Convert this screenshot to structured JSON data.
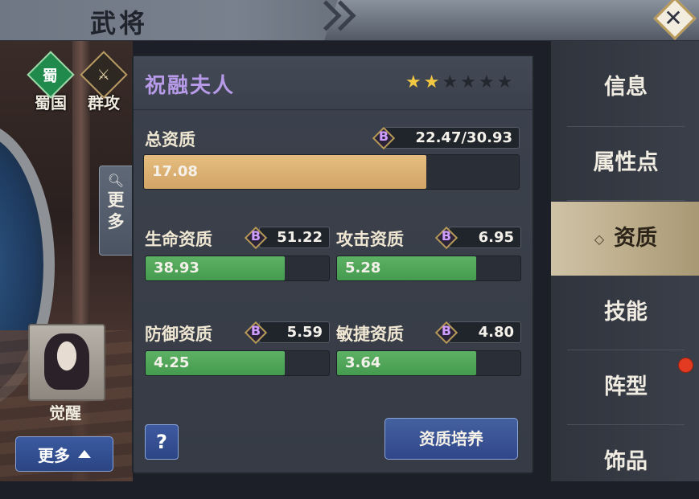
{
  "title": "武将",
  "factions": [
    {
      "emblem": "蜀",
      "label": "蜀国",
      "color": "#1f8a4c"
    },
    {
      "emblem": "⚔",
      "label": "群攻",
      "color": "#b89a62"
    }
  ],
  "side_more_tab": "更多",
  "awaken_label": "觉醒",
  "more_button": "更多",
  "hero": {
    "name": "祝融夫人",
    "stars_filled": 2,
    "stars_total": 6
  },
  "total": {
    "label": "总资质",
    "grade": "B",
    "range": "22.47/30.93",
    "current": "17.08",
    "fill_fraction": 0.754
  },
  "stats": [
    {
      "label": "生命资质",
      "grade": "B",
      "cap": "51.22",
      "current": "38.93",
      "fill_fraction": 0.76
    },
    {
      "label": "攻击资质",
      "grade": "B",
      "cap": "6.95",
      "current": "5.28",
      "fill_fraction": 0.76
    },
    {
      "label": "防御资质",
      "grade": "B",
      "cap": "5.59",
      "current": "4.25",
      "fill_fraction": 0.76
    },
    {
      "label": "敏捷资质",
      "grade": "B",
      "cap": "4.80",
      "current": "3.64",
      "fill_fraction": 0.76
    }
  ],
  "help_button": "?",
  "train_button": "资质培养",
  "nav": [
    {
      "label": "信息"
    },
    {
      "label": "属性点"
    },
    {
      "label": "资质",
      "active": true
    },
    {
      "label": "技能"
    },
    {
      "label": "阵型",
      "badge": true
    },
    {
      "label": "饰品"
    }
  ],
  "colors": {
    "accent_purple": "#b79ae8",
    "bar_gold": "#d9ad6f",
    "bar_green": "#4fa65a",
    "star_on": "#f2c842",
    "notification": "#e23b22"
  }
}
